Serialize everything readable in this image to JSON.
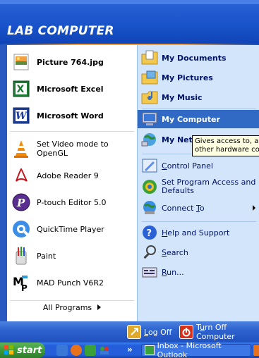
{
  "header": {
    "user_name": "LAB COMPUTER"
  },
  "pinned": [
    {
      "label": "Picture 764.jpg",
      "icon": "jpg-file-icon"
    },
    {
      "label": "Microsoft Excel",
      "icon": "excel-icon"
    },
    {
      "label": "Microsoft Word",
      "icon": "word-icon"
    }
  ],
  "recent": [
    {
      "label": "Set Video mode to OpenGL",
      "icon": "vlc-cone-icon"
    },
    {
      "label": "Adobe Reader 9",
      "icon": "adobe-reader-icon"
    },
    {
      "label": "P-touch Editor 5.0",
      "icon": "ptouch-icon"
    },
    {
      "label": "QuickTime Player",
      "icon": "quicktime-icon"
    },
    {
      "label": "Paint",
      "icon": "paint-icon"
    },
    {
      "label": "MAD Punch V6R2",
      "icon": "mad-punch-icon"
    }
  ],
  "all_programs": "All Programs",
  "places": [
    {
      "label": "My Documents",
      "icon": "my-documents-icon"
    },
    {
      "label": "My Pictures",
      "icon": "my-pictures-icon"
    },
    {
      "label": "My Music",
      "icon": "my-music-icon"
    },
    {
      "label": "My Computer",
      "icon": "my-computer-icon",
      "selected": true
    },
    {
      "label": "My Netw",
      "icon": "my-network-icon"
    }
  ],
  "system": [
    {
      "label": "Control Panel",
      "icon": "control-panel-icon"
    },
    {
      "label_line1": "Set Program Access and",
      "label_line2": "Defaults",
      "icon": "program-access-icon"
    },
    {
      "label": "Connect To",
      "icon": "connect-to-icon"
    }
  ],
  "help": [
    {
      "label": "Help and Support",
      "icon": "help-icon"
    },
    {
      "label": "Search",
      "icon": "search-icon"
    },
    {
      "label": "Run...",
      "icon": "run-icon"
    }
  ],
  "tooltip": {
    "line1": "Gives access to, and",
    "line2": "other hardware con"
  },
  "footer": {
    "logoff": "Log Off",
    "turnoff": "Turn Off Computer"
  },
  "taskbar": {
    "start": "start",
    "overflow": "»",
    "inbox_button": "Inbox - Microsoft Outlook"
  },
  "colors": {
    "header_blue": "#1852c9",
    "selection": "#316ac5",
    "right_pane": "#d3e5fa",
    "start_green": "#3c9a38"
  }
}
